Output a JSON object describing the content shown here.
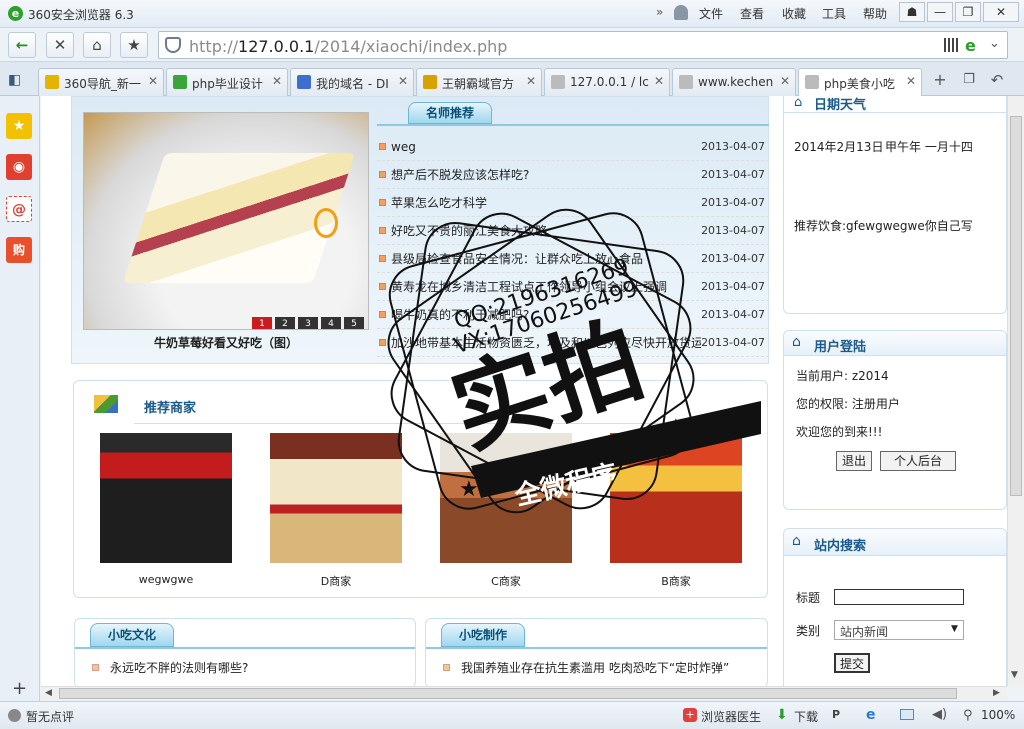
{
  "window": {
    "title": "360安全浏览器 6.3",
    "menu": [
      "文件",
      "查看",
      "收藏",
      "工具",
      "帮助"
    ]
  },
  "address": {
    "proto": "http://",
    "host": "127.0.0.1",
    "path": "/2014/xiaochi/index.php"
  },
  "tabs": [
    {
      "label": "360导航_新一",
      "color": "#e5b400"
    },
    {
      "label": "php毕业设计",
      "color": "#3aa63a"
    },
    {
      "label": "我的域名 - DI",
      "color": "#3d6fd0"
    },
    {
      "label": "王朝霸域官方",
      "color": "#d9a000"
    },
    {
      "label": "127.0.0.1 / lc",
      "color": "#bbbbbb"
    },
    {
      "label": "www.kechen",
      "color": "#bbbbbb"
    },
    {
      "label": "php美食小吃",
      "color": "#bbbbbb"
    }
  ],
  "slideshow": {
    "caption": "牛奶草莓好看又好吃（图）",
    "pages": [
      "1",
      "2",
      "3",
      "4",
      "5"
    ]
  },
  "teachers": {
    "title": "名师推荐",
    "items": [
      {
        "t": "weg",
        "d": "2013-04-07"
      },
      {
        "t": "想产后不脱发应该怎样吃?",
        "d": "2013-04-07"
      },
      {
        "t": "苹果怎么吃才科学",
        "d": "2013-04-07"
      },
      {
        "t": "好吃又不贵的丽江美食大攻略",
        "d": "2013-04-07"
      },
      {
        "t": "县级局检查食品安全情况：让群众吃上放心食品",
        "d": "2013-04-07"
      },
      {
        "t": "黄寿龙在城乡清洁工程试点工作领导小组会议上强调",
        "d": "2013-04-07"
      },
      {
        "t": "喝牛奶真的不利于减肥吗?",
        "d": "2013-04-07"
      },
      {
        "t": "加沙地带基本生活物资匮乏，埃及和以色列应尽快开放货运口岸",
        "d": "2013-04-07"
      }
    ]
  },
  "merchants": {
    "title": "推荐商家",
    "items": [
      {
        "name": "wegwgwe"
      },
      {
        "name": "D商家"
      },
      {
        "name": "C商家"
      },
      {
        "name": "B商家"
      }
    ]
  },
  "culture": {
    "title": "小吃文化",
    "items": [
      "永远吃不胖的法则有哪些?"
    ]
  },
  "making": {
    "title": "小吃制作",
    "items": [
      "我国养殖业存在抗生素滥用 吃肉恐吃下“定时炸弹”"
    ]
  },
  "date_weather": {
    "title": "日期天气",
    "date": "2014年2月13日",
    "lunar": "甲午年 一月十四",
    "recommend": "推荐饮食:gfewgwegwe你自己写"
  },
  "login": {
    "title": "用户登陆",
    "user": "当前用户: z2014",
    "perm": "您的权限: 注册用户",
    "welcome": "欢迎您的到来!!!",
    "logout": "退出",
    "backend": "个人后台"
  },
  "search": {
    "title": "站内搜索",
    "label_title": "标题",
    "label_type": "类别",
    "type_value": "站内新闻",
    "submit": "提交"
  },
  "status": {
    "comment": "暂无点评",
    "doctor": "浏览器医生",
    "download": "下载",
    "zoom": "100%"
  },
  "watermark": {
    "qq": "QQ:2196316269",
    "vx": "VX:17060256499",
    "big": "实拍",
    "banner": "全微程序"
  }
}
